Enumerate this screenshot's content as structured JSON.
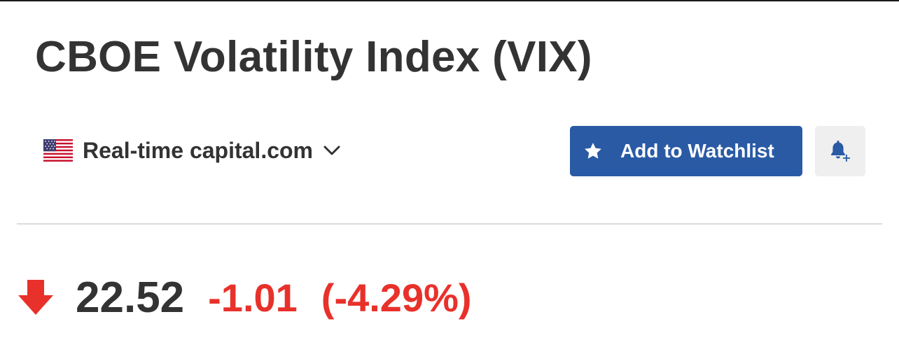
{
  "header": {
    "title": "CBOE Volatility Index (VIX)"
  },
  "source": {
    "flag_icon": "us-flag-icon",
    "label": "Real-time capital.com",
    "dropdown_icon": "chevron-down-icon"
  },
  "actions": {
    "watchlist_label": "Add to Watchlist",
    "watchlist_icon": "star-icon",
    "alert_icon": "bell-plus-icon"
  },
  "quote": {
    "direction_icon": "arrow-down-icon",
    "price": "22.52",
    "change": "-1.01",
    "change_percent": "(-4.29%)"
  },
  "colors": {
    "accent": "#2a5aa4",
    "negative": "#e8312a",
    "text": "#333333",
    "bell_button_bg": "#efefef",
    "divider": "#dcdcdc"
  }
}
